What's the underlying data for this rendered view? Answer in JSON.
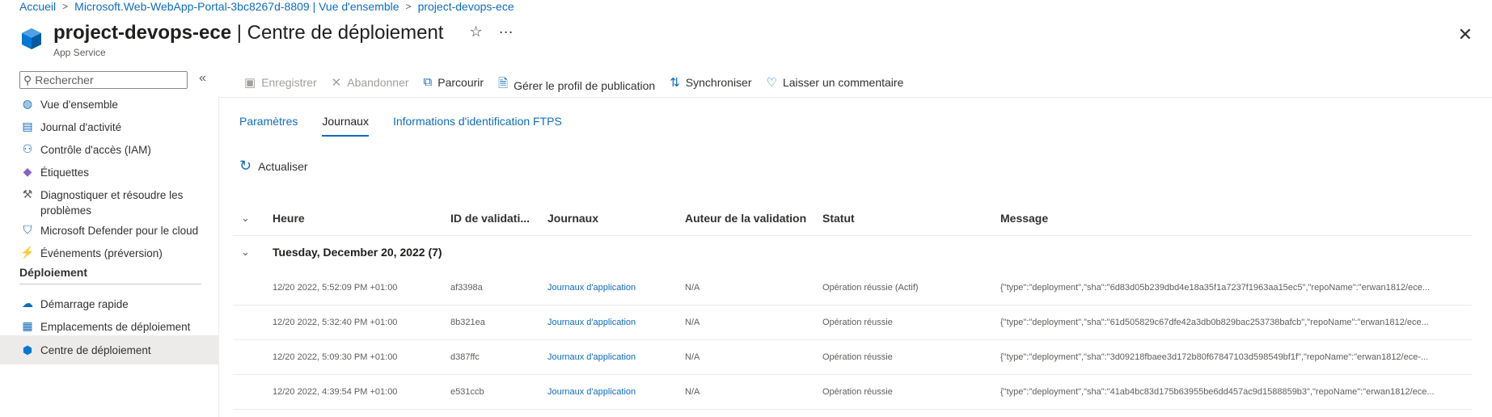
{
  "breadcrumb": [
    "Accueil",
    "Microsoft.Web-WebApp-Portal-3bc8267d-8809 | Vue d'ensemble",
    "project-devops-ece"
  ],
  "header": {
    "title_bold": "project-devops-ece",
    "title_rest": " | Centre de déploiement",
    "subtitle": "App Service"
  },
  "sidebar": {
    "search_placeholder": "Rechercher",
    "items": [
      {
        "label": "Vue d'ensemble",
        "icon": "globe-icon"
      },
      {
        "label": "Journal d'activité",
        "icon": "log-icon"
      },
      {
        "label": "Contrôle d'accès (IAM)",
        "icon": "people-icon"
      },
      {
        "label": "Étiquettes",
        "icon": "tag-icon"
      },
      {
        "label": "Diagnostiquer et résoudre les problèmes",
        "icon": "wrench-icon"
      },
      {
        "label": "Microsoft Defender pour le cloud",
        "icon": "shield-icon"
      },
      {
        "label": "Événements (préversion)",
        "icon": "bolt-icon"
      }
    ],
    "section": "Déploiement",
    "deploy_items": [
      {
        "label": "Démarrage rapide",
        "icon": "rocket-icon"
      },
      {
        "label": "Emplacements de déploiement",
        "icon": "slots-icon"
      },
      {
        "label": "Centre de déploiement",
        "icon": "cube-icon"
      }
    ]
  },
  "toolbar": {
    "save": "Enregistrer",
    "discard": "Abandonner",
    "browse": "Parcourir",
    "publish_profile": "Gérer le profil de publication",
    "sync": "Synchroniser",
    "feedback": "Laisser un commentaire"
  },
  "tabs": [
    "Paramètres",
    "Journaux",
    "Informations d'identification FTPS"
  ],
  "refresh_label": "Actualiser",
  "columns": [
    "Heure",
    "ID de validati...",
    "Journaux",
    "Auteur de la validation",
    "Statut",
    "Message"
  ],
  "group_label": "Tuesday, December 20, 2022 (7)",
  "rows": [
    {
      "time": "12/20 2022, 5:52:09 PM +01:00",
      "id": "af3398a",
      "logs": "Journaux d'application",
      "author": "N/A",
      "status": "Opération réussie (Actif)",
      "message": "{\"type\":\"deployment\",\"sha\":\"6d83d05b239dbd4e18a35f1a7237f1963aa15ec5\",\"repoName\":\"erwan1812/ece..."
    },
    {
      "time": "12/20 2022, 5:32:40 PM +01:00",
      "id": "8b321ea",
      "logs": "Journaux d'application",
      "author": "N/A",
      "status": "Opération réussie",
      "message": "{\"type\":\"deployment\",\"sha\":\"61d505829c67dfe42a3db0b829bac253738bafcb\",\"repoName\":\"erwan1812/ece..."
    },
    {
      "time": "12/20 2022, 5:09:30 PM +01:00",
      "id": "d387ffc",
      "logs": "Journaux d'application",
      "author": "N/A",
      "status": "Opération réussie",
      "message": "{\"type\":\"deployment\",\"sha\":\"3d09218fbaee3d172b80f67847103d598549bf1f\",\"repoName\":\"erwan1812/ece-..."
    },
    {
      "time": "12/20 2022, 4:39:54 PM +01:00",
      "id": "e531ccb",
      "logs": "Journaux d'application",
      "author": "N/A",
      "status": "Opération réussie",
      "message": "{\"type\":\"deployment\",\"sha\":\"41ab4bc83d175b63955be6dd457ac9d1588859b3\",\"repoName\":\"erwan1812/ece..."
    }
  ]
}
